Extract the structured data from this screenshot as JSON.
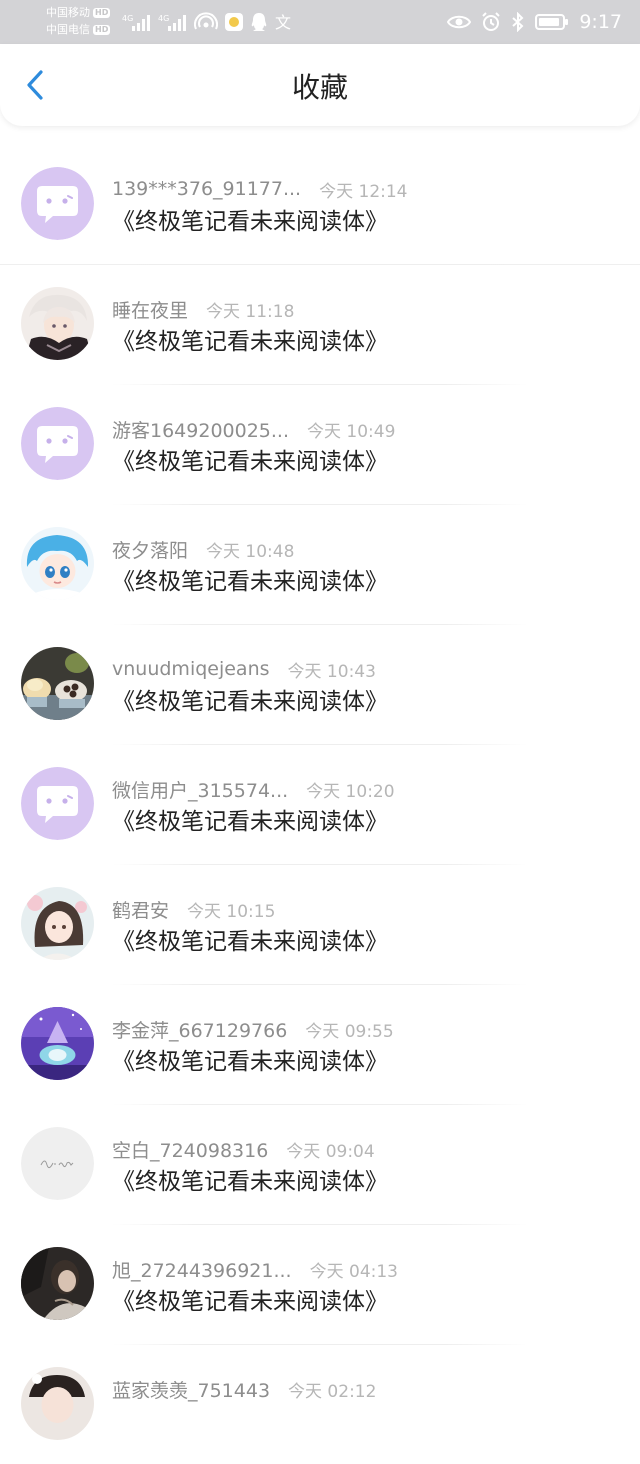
{
  "status_bar": {
    "carrier1": "中国移动",
    "carrier2": "中国电信",
    "hd": "HD",
    "net1": "4G",
    "net2": "4G",
    "time": "9:17",
    "colors": {
      "bar": "#d3d3d6",
      "fg": "#ffffff"
    }
  },
  "header": {
    "title": "收藏",
    "back_icon": "chevron-left-icon",
    "accent": "#2e8bdc"
  },
  "items": [
    {
      "username": "139***376_91177...",
      "time": "今天 12:14",
      "content": "《终极笔记看未来阅读体》",
      "avatar": "default-bubble"
    },
    {
      "username": "睡在夜里",
      "time": "今天 11:18",
      "content": "《终极笔记看未来阅读体》",
      "avatar": "anime-white-hair"
    },
    {
      "username": "游客1649200025...",
      "time": "今天 10:49",
      "content": "《终极笔记看未来阅读体》",
      "avatar": "default-bubble"
    },
    {
      "username": "夜夕落阳",
      "time": "今天 10:48",
      "content": "《终极笔记看未来阅读体》",
      "avatar": "anime-blue-hair"
    },
    {
      "username": "vnuudmiqejeans",
      "time": "今天 10:43",
      "content": "《终极笔记看未来阅读体》",
      "avatar": "dessert-photo"
    },
    {
      "username": "微信用户_315574...",
      "time": "今天 10:20",
      "content": "《终极笔记看未来阅读体》",
      "avatar": "default-bubble"
    },
    {
      "username": "鹤君安",
      "time": "今天 10:15",
      "content": "《终极笔记看未来阅读体》",
      "avatar": "anime-girl-flowers"
    },
    {
      "username": "李金萍_667129766",
      "time": "今天 09:55",
      "content": "《终极笔记看未来阅读体》",
      "avatar": "purple-night-scene"
    },
    {
      "username": "空白_724098316",
      "time": "今天 09:04",
      "content": "《终极笔记看未来阅读体》",
      "avatar": "grey-script-logo"
    },
    {
      "username": "旭_27244396921...",
      "time": "今天 04:13",
      "content": "《终极笔记看未来阅读体》",
      "avatar": "dark-portrait-photo"
    },
    {
      "username": "蓝家羡羡_751443",
      "time": "今天 02:12",
      "content": "",
      "avatar": "partial-cut-off"
    }
  ]
}
